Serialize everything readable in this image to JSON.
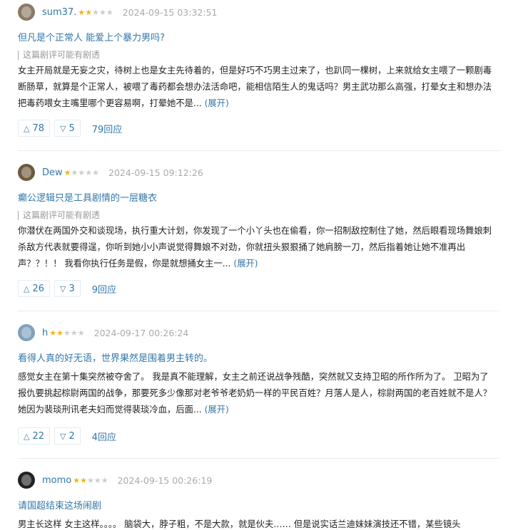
{
  "reviews": [
    {
      "user": "sum37.",
      "rating": 2,
      "time": "2024-09-15 03:32:51",
      "title": "但凡是个正常人 能爱上个暴力男吗?",
      "spoiler": "这篇剧评可能有剧透",
      "body": "女主开局就是无妄之灾，待树上也是女主先待着的，但是好巧不巧男主过来了，也趴同一棵树，上来就给女主喂了一颗剧毒断肠草，就算是个正常人，被喂了毒药都会想办法活命吧，能相信陌生人的鬼话吗？男主武功那么高强，打晕女主和想办法把毒药喂女主嘴里哪个更容易啊，打晕她不是...",
      "expand": "(展开)",
      "up": "78",
      "down": "5",
      "replies": "79回应"
    },
    {
      "user": "Dew",
      "rating": 1,
      "time": "2024-09-15 09:12:26",
      "title": "癫公逻辑只是工具剧情的一层糖衣",
      "spoiler": "这篇剧评可能有剧透",
      "body": "你潜伏在两国外交和谈现场，执行重大计划，你发现了一个小丫头也在偷看，你一招制敌控制住了她，然后眼看现场舞娘刺杀敌方代表就要得逞，你听到她小小声说觉得舞娘不对劲，你就扭头狠狠捅了她肩膀一刀，然后指着她让她不准再出声？？！！ 我看你执行任务是假，你是就想捅女主一...",
      "expand": "(展开)",
      "up": "26",
      "down": "3",
      "replies": "9回应"
    },
    {
      "user": "h",
      "rating": 2,
      "time": "2024-09-17 00:26:24",
      "title": "看得人真的好无语，世界果然是围着男主转的。",
      "spoiler": "",
      "body": "感觉女主在第十集突然被夺舍了。 我是真不能理解，女主之前还说战争残酷，突然就又支持卫昭的所作所为了。 卫昭为了报仇要挑起棕尉两国的战争，那要死多少像那对老爷爷老奶奶一样的平民百姓？月落人是人，棕尉两国的老百姓就不是人？她因为裴琰刑讯老夫妇而觉得裴琰冷血，后面...",
      "expand": "(展开)",
      "up": "22",
      "down": "2",
      "replies": "4回应"
    },
    {
      "user": "momo",
      "rating": 2,
      "time": "2024-09-15 00:26:19",
      "title": "请国超结束这场闹剧",
      "spoiler": "",
      "body": "男主长这样 女主这样。。。。 脑袋大，脖子粗，不是大款，就是伙夫…… 但是说实话兰迪妹妹演技还不错，某些镜头",
      "expand": "",
      "up": "",
      "down": "",
      "replies": ""
    }
  ],
  "icons": {
    "up": "triangle-up-icon",
    "down": "triangle-down-icon",
    "star": "star-icon"
  },
  "colors": {
    "link": "#3377aa",
    "star": "#f5b219",
    "meta": "#aaaaaa"
  }
}
